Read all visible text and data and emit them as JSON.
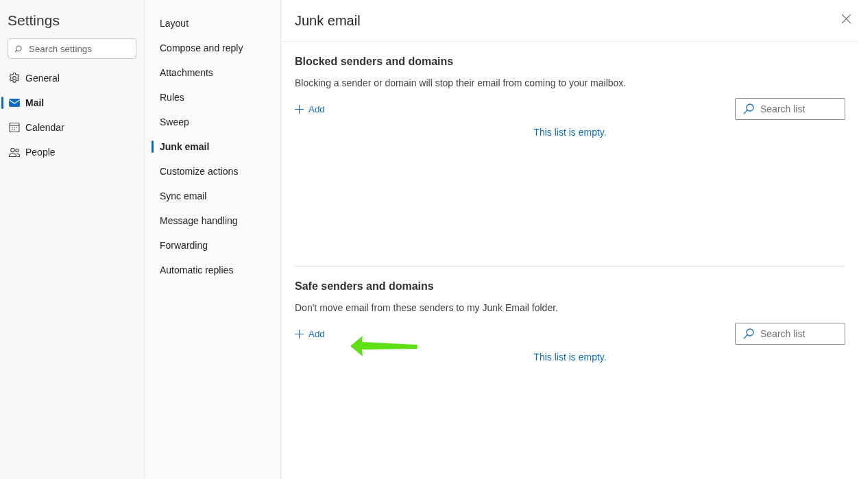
{
  "sidebar": {
    "title": "Settings",
    "search": {
      "placeholder": "Search settings"
    },
    "items": [
      {
        "label": "General",
        "selected": false
      },
      {
        "label": "Mail",
        "selected": true
      },
      {
        "label": "Calendar",
        "selected": false
      },
      {
        "label": "People",
        "selected": false
      }
    ]
  },
  "subnav": {
    "items": [
      {
        "label": "Layout",
        "selected": false
      },
      {
        "label": "Compose and reply",
        "selected": false
      },
      {
        "label": "Attachments",
        "selected": false
      },
      {
        "label": "Rules",
        "selected": false
      },
      {
        "label": "Sweep",
        "selected": false
      },
      {
        "label": "Junk email",
        "selected": true
      },
      {
        "label": "Customize actions",
        "selected": false
      },
      {
        "label": "Sync email",
        "selected": false
      },
      {
        "label": "Message handling",
        "selected": false
      },
      {
        "label": "Forwarding",
        "selected": false
      },
      {
        "label": "Automatic replies",
        "selected": false
      }
    ]
  },
  "panel": {
    "title": "Junk email",
    "sections": [
      {
        "title": "Blocked senders and domains",
        "description": "Blocking a sender or domain will stop their email from coming to your mailbox.",
        "add_label": "Add",
        "search": {
          "placeholder": "Search list"
        },
        "empty_text": "This list is empty."
      },
      {
        "title": "Safe senders and domains",
        "description": "Don't move email from these senders to my Junk Email folder.",
        "add_label": "Add",
        "search": {
          "placeholder": "Search list"
        },
        "empty_text": "This list is empty."
      }
    ]
  }
}
